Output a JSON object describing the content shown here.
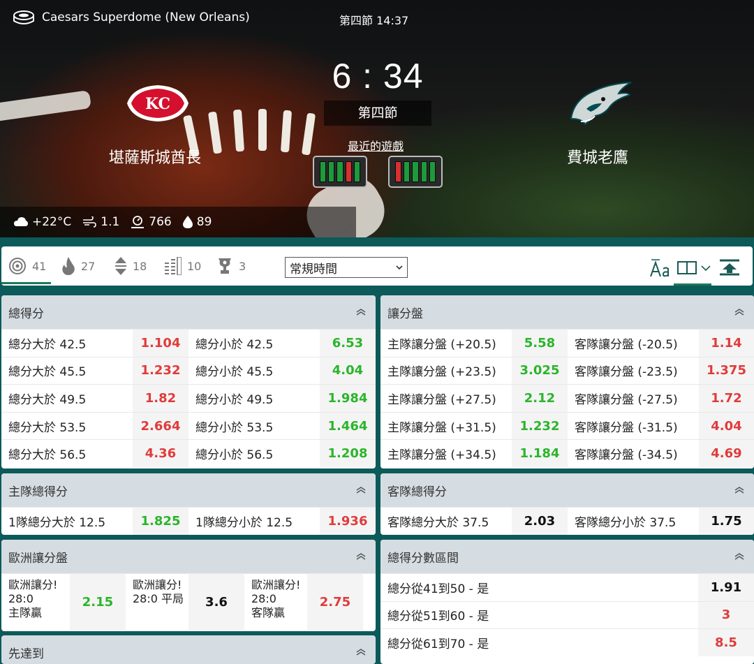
{
  "header": {
    "venue": "Caesars Superdome (New Orleans)",
    "period_time": "第四節 14:37",
    "score": "6 : 34",
    "period": "第四節",
    "recent_games_label": "最近的遊戲",
    "home_team": "堪薩斯城酋長",
    "away_team": "費城老鷹",
    "home_logo_text": "KC",
    "home_form": [
      "W",
      "W",
      "W",
      "L",
      "W"
    ],
    "away_form": [
      "L",
      "W",
      "W",
      "W",
      "W"
    ],
    "weather": {
      "temp": "+22°C",
      "wind": "1.1",
      "pressure": "766",
      "humidity": "89"
    }
  },
  "toolbar": {
    "tabs": [
      {
        "icon": "target-icon",
        "count": "41"
      },
      {
        "icon": "fire-icon",
        "count": "27"
      },
      {
        "icon": "updown-icon",
        "count": "18"
      },
      {
        "icon": "bars-icon",
        "count": "10"
      },
      {
        "icon": "trophy-icon",
        "count": "3"
      }
    ],
    "period_select": "常規時間"
  },
  "colors": {
    "red": "#e13b3b",
    "green": "#2ab52a",
    "header_bg": "#d6dde2",
    "brand": "#0c5a5a"
  },
  "markets": {
    "total": {
      "title": "總得分",
      "rows": [
        {
          "a": "總分大於 42.5",
          "ao": "1.104",
          "ac": "red",
          "b": "總分小於 42.5",
          "bo": "6.53",
          "bc": "green"
        },
        {
          "a": "總分大於 45.5",
          "ao": "1.232",
          "ac": "red",
          "b": "總分小於 45.5",
          "bo": "4.04",
          "bc": "green"
        },
        {
          "a": "總分大於 49.5",
          "ao": "1.82",
          "ac": "red",
          "b": "總分小於 49.5",
          "bo": "1.984",
          "bc": "green"
        },
        {
          "a": "總分大於 53.5",
          "ao": "2.664",
          "ac": "red",
          "b": "總分小於 53.5",
          "bo": "1.464",
          "bc": "green"
        },
        {
          "a": "總分大於 56.5",
          "ao": "4.36",
          "ac": "red",
          "b": "總分小於 56.5",
          "bo": "1.208",
          "bc": "green"
        }
      ]
    },
    "handicap": {
      "title": "讓分盤",
      "rows": [
        {
          "a": "主隊讓分盤 (+20.5)",
          "ao": "5.58",
          "ac": "green",
          "b": "客隊讓分盤 (-20.5)",
          "bo": "1.14",
          "bc": "red"
        },
        {
          "a": "主隊讓分盤 (+23.5)",
          "ao": "3.025",
          "ac": "green",
          "b": "客隊讓分盤 (-23.5)",
          "bo": "1.375",
          "bc": "red"
        },
        {
          "a": "主隊讓分盤 (+27.5)",
          "ao": "2.12",
          "ac": "green",
          "b": "客隊讓分盤 (-27.5)",
          "bo": "1.72",
          "bc": "red"
        },
        {
          "a": "主隊讓分盤 (+31.5)",
          "ao": "1.232",
          "ac": "green",
          "b": "客隊讓分盤 (-31.5)",
          "bo": "4.04",
          "bc": "red"
        },
        {
          "a": "主隊讓分盤 (+34.5)",
          "ao": "1.184",
          "ac": "green",
          "b": "客隊讓分盤 (-34.5)",
          "bo": "4.69",
          "bc": "red"
        }
      ]
    },
    "home_total": {
      "title": "主隊總得分",
      "rows": [
        {
          "a": "1隊總分大於 12.5",
          "ao": "1.825",
          "ac": "green",
          "b": "1隊總分小於 12.5",
          "bo": "1.936",
          "bc": "red"
        }
      ]
    },
    "away_total": {
      "title": "客隊總得分",
      "rows": [
        {
          "a": "客隊總分大於 37.5",
          "ao": "2.03",
          "ac": "black",
          "b": "客隊總分小於 37.5",
          "bo": "1.75",
          "bc": "black"
        }
      ]
    },
    "euro_handicap": {
      "title": "歐洲讓分盤",
      "items": [
        {
          "l1": "歐洲讓分!",
          "l2": "28:0",
          "l3": "主隊贏",
          "odd": "2.15",
          "c": "green"
        },
        {
          "l1": "歐洲讓分!",
          "l2": "28:0 平局",
          "l3": "",
          "odd": "3.6",
          "c": "black"
        },
        {
          "l1": "歐洲讓分!",
          "l2": "28:0",
          "l3": "客隊贏",
          "odd": "2.75",
          "c": "red"
        }
      ]
    },
    "range": {
      "title": "總得分數區間",
      "rows": [
        {
          "a": "總分從41到50 - 是",
          "o": "1.91",
          "c": "black"
        },
        {
          "a": "總分從51到60 - 是",
          "o": "3",
          "c": "red"
        },
        {
          "a": "總分從61到70 - 是",
          "o": "8.5",
          "c": "red"
        }
      ]
    },
    "race_to": {
      "title": "先達到"
    }
  }
}
